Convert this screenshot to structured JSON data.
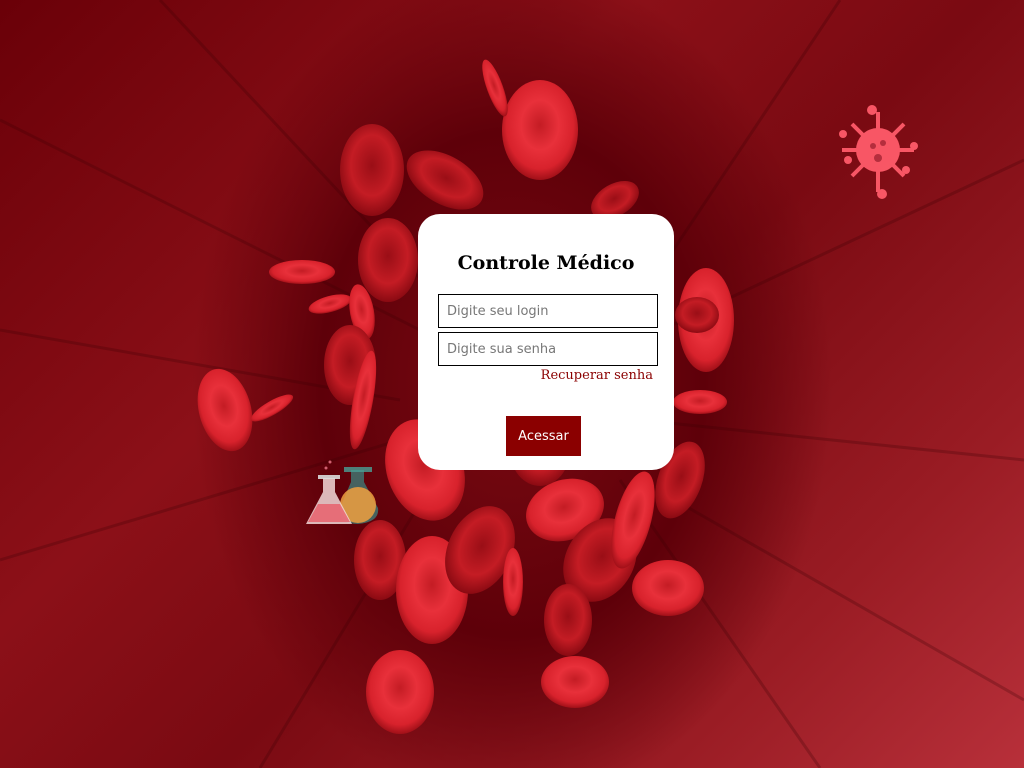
{
  "login": {
    "title": "Controle Médico",
    "login_placeholder": "Digite seu login",
    "login_value": "",
    "password_placeholder": "Digite sua senha",
    "password_value": "",
    "recover_label": "Recuperar senha",
    "submit_label": "Acessar"
  },
  "theme": {
    "accent": "#8b0000",
    "background": "#7a0a12",
    "card": "#ffffff"
  },
  "decorations": {
    "background_image": "red-blood-cells",
    "virus_icon": "virus-icon",
    "flask_icon": "lab-flasks-icon"
  }
}
